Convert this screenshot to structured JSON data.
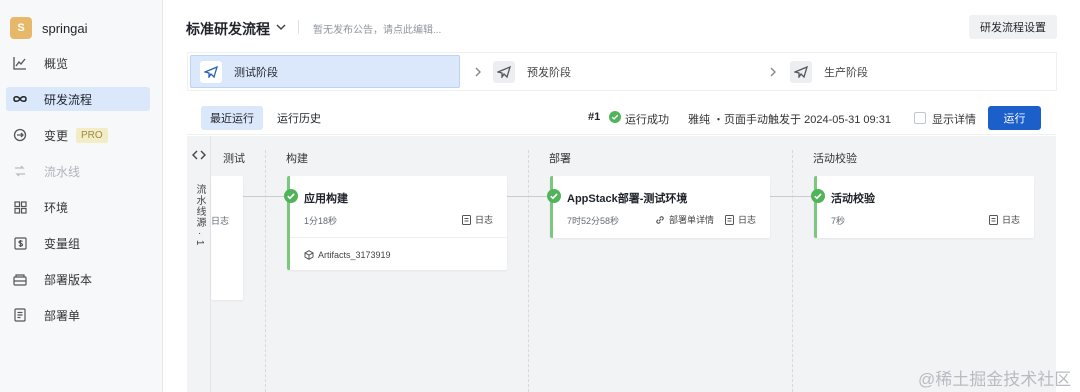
{
  "app": {
    "avatar_letter": "S",
    "name": "springai"
  },
  "sidebar": {
    "items": [
      {
        "label": "概览",
        "icon": "line-chart-icon"
      },
      {
        "label": "研发流程",
        "icon": "infinity-icon",
        "active": true
      },
      {
        "label": "变更",
        "icon": "changes-icon",
        "badge": "PRO"
      },
      {
        "label": "流水线",
        "icon": "pipeline-icon",
        "disabled": true
      },
      {
        "label": "环境",
        "icon": "grid-icon"
      },
      {
        "label": "变量组",
        "icon": "variable-icon"
      },
      {
        "label": "部署版本",
        "icon": "package-icon"
      },
      {
        "label": "部署单",
        "icon": "document-icon"
      }
    ]
  },
  "header": {
    "title": "标准研发流程",
    "notice": "暂无发布公告，请点此编辑...",
    "settings_label": "研发流程设置"
  },
  "stages": [
    {
      "label": "测试阶段",
      "active": true
    },
    {
      "label": "预发阶段"
    },
    {
      "label": "生产阶段"
    }
  ],
  "runbar": {
    "tab_recent": "最近运行",
    "tab_history": "运行历史",
    "run_number": "#1",
    "status": "运行成功",
    "trigger": "雅纯 ・页面手动触发于 2024-05-31 09:31",
    "show_detail": "显示详情",
    "run_button": "运行"
  },
  "pipeline": {
    "vertical_label": "流水线源 · 1",
    "columns": [
      "测试",
      "构建",
      "部署",
      "活动校验"
    ],
    "test_card": {
      "log": "日志"
    },
    "build_card": {
      "title": "应用构建",
      "duration": "1分18秒",
      "log": "日志",
      "artifact": "Artifacts_3173919"
    },
    "deploy_card": {
      "title": "AppStack部署-测试环境",
      "duration": "7时52分58秒",
      "detail": "部署单详情",
      "log": "日志"
    },
    "verify_card": {
      "title": "活动校验",
      "duration": "7秒",
      "log": "日志"
    }
  },
  "colors": {
    "accent": "#1b5fcb",
    "active_bg": "#dbe7fb",
    "success": "#52b45a"
  },
  "watermark": "@稀土掘金技术社区"
}
